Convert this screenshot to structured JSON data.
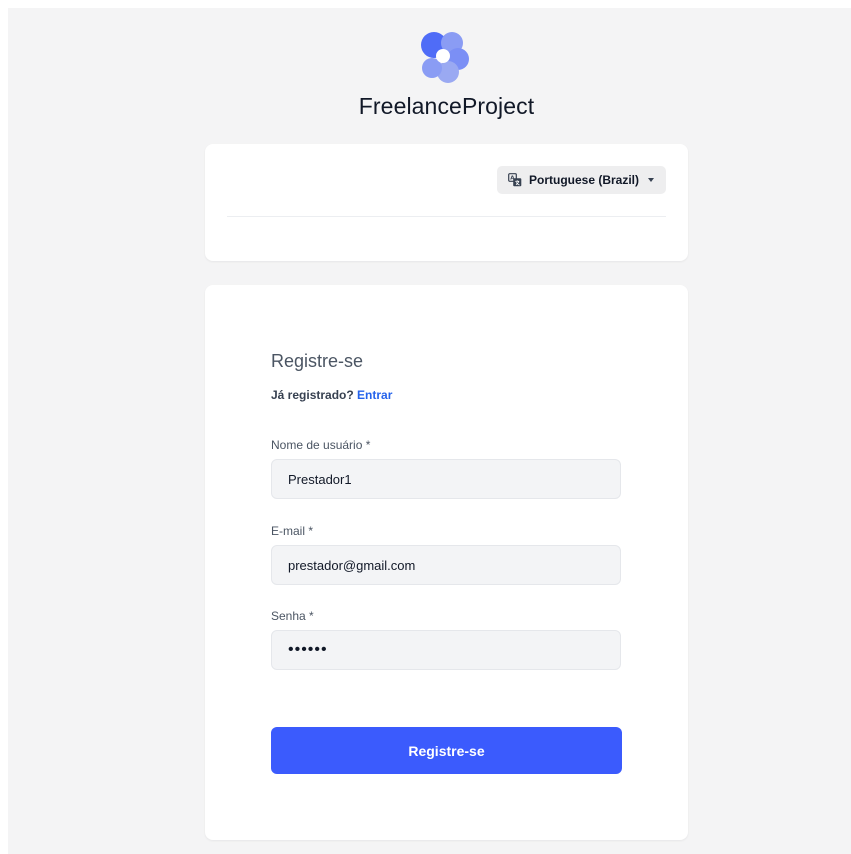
{
  "brand": {
    "name": "FreelanceProject",
    "logo_icon": "petal-flower-logo",
    "logo_colors": [
      "#4f6cf7",
      "#7b8ff5",
      "#9aa9f2"
    ]
  },
  "language_selector": {
    "label": "Portuguese (Brazil)",
    "icon": "translate-icon"
  },
  "form": {
    "title": "Registre-se",
    "login_prompt": "Já registrado?",
    "login_link": "Entrar",
    "username": {
      "label": "Nome de usuário *",
      "value": "Prestador1"
    },
    "email": {
      "label": "E-mail *",
      "value": "prestador@gmail.com"
    },
    "password": {
      "label": "Senha *",
      "value": "123456"
    },
    "submit_label": "Registre-se"
  },
  "colors": {
    "accent": "#3b5bfd",
    "link": "#2563eb",
    "background": "#f4f4f5"
  }
}
